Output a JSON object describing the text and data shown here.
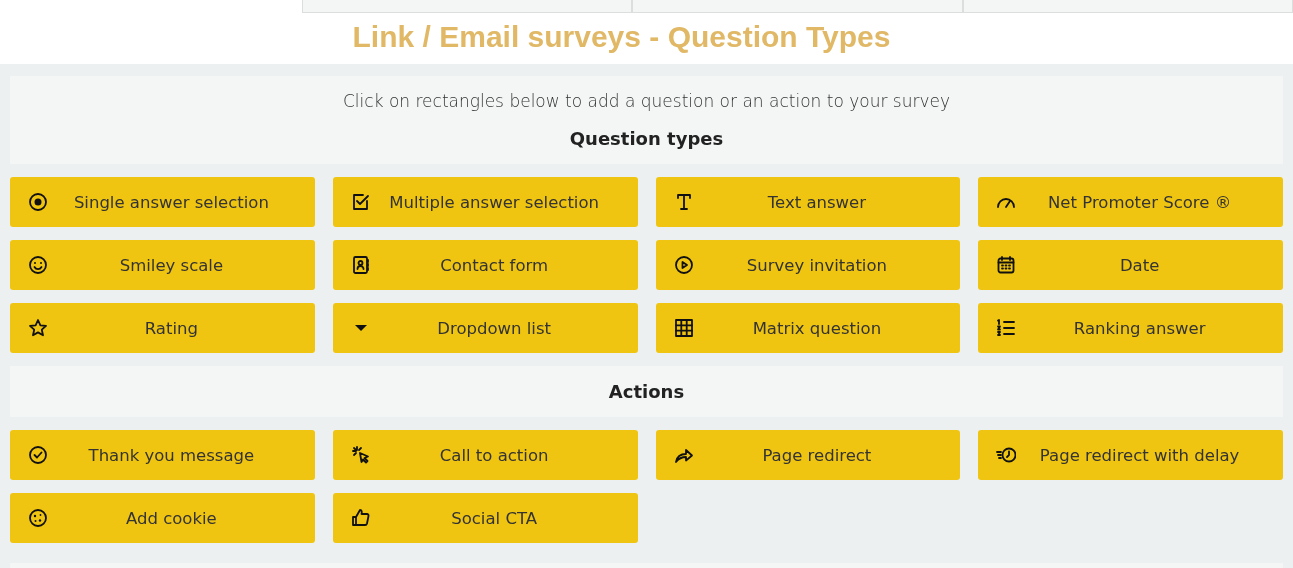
{
  "title": "Link / Email surveys - Question Types",
  "intro": "Click on rectangles below to add a question or an action to your survey",
  "sections": [
    {
      "heading": "Question types",
      "items": [
        {
          "label": "Single answer selection"
        },
        {
          "label": "Multiple answer selection"
        },
        {
          "label": "Text answer"
        },
        {
          "label": "Net Promoter Score ®"
        },
        {
          "label": "Smiley scale"
        },
        {
          "label": "Contact form"
        },
        {
          "label": "Survey invitation"
        },
        {
          "label": "Date"
        },
        {
          "label": "Rating"
        },
        {
          "label": "Dropdown list"
        },
        {
          "label": "Matrix question"
        },
        {
          "label": "Ranking answer"
        }
      ]
    },
    {
      "heading": "Actions",
      "items": [
        {
          "label": "Thank you message"
        },
        {
          "label": "Call to action"
        },
        {
          "label": "Page redirect"
        },
        {
          "label": "Page redirect with delay"
        },
        {
          "label": "Add cookie"
        },
        {
          "label": "Social CTA"
        }
      ]
    }
  ]
}
